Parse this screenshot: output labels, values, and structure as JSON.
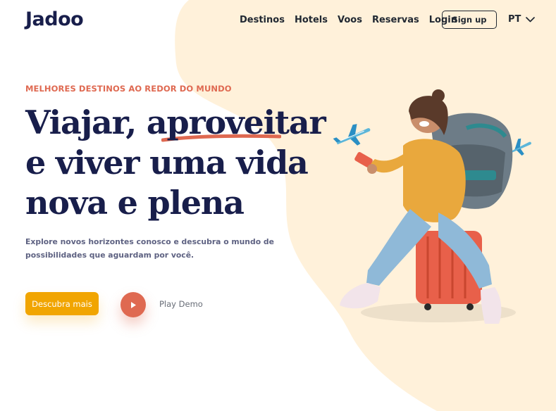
{
  "brand": {
    "logo_text": "Jadoo"
  },
  "nav": {
    "links": [
      "Destinos",
      "Hotels",
      "Voos",
      "Reservas",
      "Login"
    ],
    "signup_label": "Sign up",
    "language": "PT"
  },
  "hero": {
    "eyebrow": "MELHORES DESTINOS AO REDOR DO MUNDO",
    "headline_lines": [
      "Viajar, aproveitar",
      "e viver uma vida",
      "nova e plena"
    ],
    "subtitle": "Explore novos horizontes conosco e descubra o mundo de possibilidades que aguardam por você.",
    "cta_label": "Descubra mais",
    "play_label": "Play Demo"
  },
  "colors": {
    "accent_orange": "#DF6951",
    "cta_yellow": "#F1A501",
    "blob_cream": "#FFF1DA",
    "heading_navy": "#181E4B",
    "body_gray": "#5E6282"
  },
  "icons": {
    "language_dropdown": "chevron-down-icon",
    "play": "play-icon",
    "decorations": [
      "airplane-icon",
      "airplane-icon"
    ],
    "illustration": "traveler-with-backpack-on-suitcase"
  }
}
